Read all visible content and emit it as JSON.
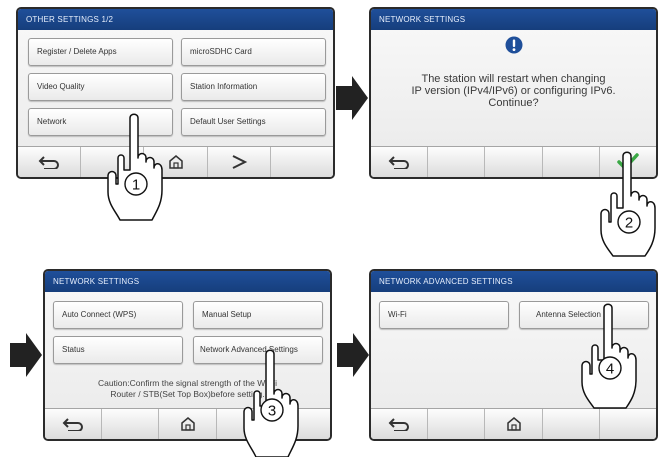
{
  "panel1": {
    "title": "OTHER SETTINGS  1/2",
    "buttons": [
      "Register / Delete Apps",
      "microSDHC Card",
      "Video Quality",
      "Station Information",
      "Network",
      "Default User Settings"
    ],
    "nav": [
      "back-icon",
      "",
      "home-icon",
      "next-icon",
      ""
    ],
    "step": "1"
  },
  "panel2": {
    "title": "NETWORK SETTINGS",
    "alert_icon": "exclamation-icon",
    "message": [
      "The station will restart when changing",
      "IP version (IPv4/IPv6) or configuring IPv6.",
      "Continue?"
    ],
    "nav": [
      "back-icon",
      "",
      "",
      "",
      "check-icon"
    ],
    "step": "2"
  },
  "panel3": {
    "title": "NETWORK SETTINGS",
    "buttons": [
      "Auto Connect (WPS)",
      "Manual Setup",
      "Status",
      "Network Advanced Settings"
    ],
    "caution": [
      "Caution:Confirm the signal strength of the Wi-Fi",
      "Router / STB(Set Top Box)before setting."
    ],
    "nav": [
      "back-icon",
      "",
      "home-icon",
      "",
      ""
    ],
    "step": "3"
  },
  "panel4": {
    "title": "NETWORK ADVANCED SETTINGS",
    "buttons": [
      "Wi-Fi",
      "Antenna Selection"
    ],
    "nav": [
      "back-icon",
      "",
      "home-icon",
      "",
      ""
    ],
    "step": "4"
  },
  "colors": {
    "titlebar": "#1f4f9a",
    "check": "#3aa845",
    "alert": "#1f4f9a",
    "arrow": "#222222"
  }
}
